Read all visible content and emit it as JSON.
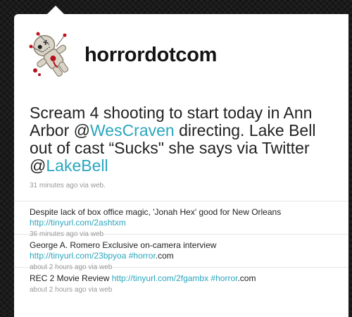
{
  "profile": {
    "screen_name": "horrordotcom"
  },
  "main_tweet": {
    "text_1": "Scream 4 shooting to start today in Ann Arbor @",
    "mention_1": "WesCraven",
    "text_2": " directing. Lake Bell out of cast “Sucks\" she says via Twitter @",
    "mention_2": "LakeBell",
    "time": "31 minutes ago",
    "via_label": " via ",
    "source": "web."
  },
  "tweets": [
    {
      "text": "Despite lack of box office magic, 'Jonah Hex' good for New Orleans ",
      "link": "http://tinyurl.com/2ashtxm",
      "hashtag": "",
      "tail": "",
      "time": "36 minutes ago",
      "via_label": " via ",
      "source": "web"
    },
    {
      "text": "George A. Romero Exclusive on-camera interview ",
      "link": "http://tinyurl.com/23bpyoa",
      "hashtag": " #horror",
      "tail": ".com",
      "time": "about 2 hours ago",
      "via_label": " via ",
      "source": "web"
    },
    {
      "text": "REC 2 Movie Review ",
      "link": "http://tinyurl.com/2fgambx",
      "hashtag": " #horror",
      "tail": ".com",
      "time": "about 2 hours ago",
      "via_label": " via ",
      "source": "web"
    }
  ],
  "colors": {
    "link": "#2aa6bd",
    "background": "#1a1a1a",
    "card": "#ffffff"
  }
}
